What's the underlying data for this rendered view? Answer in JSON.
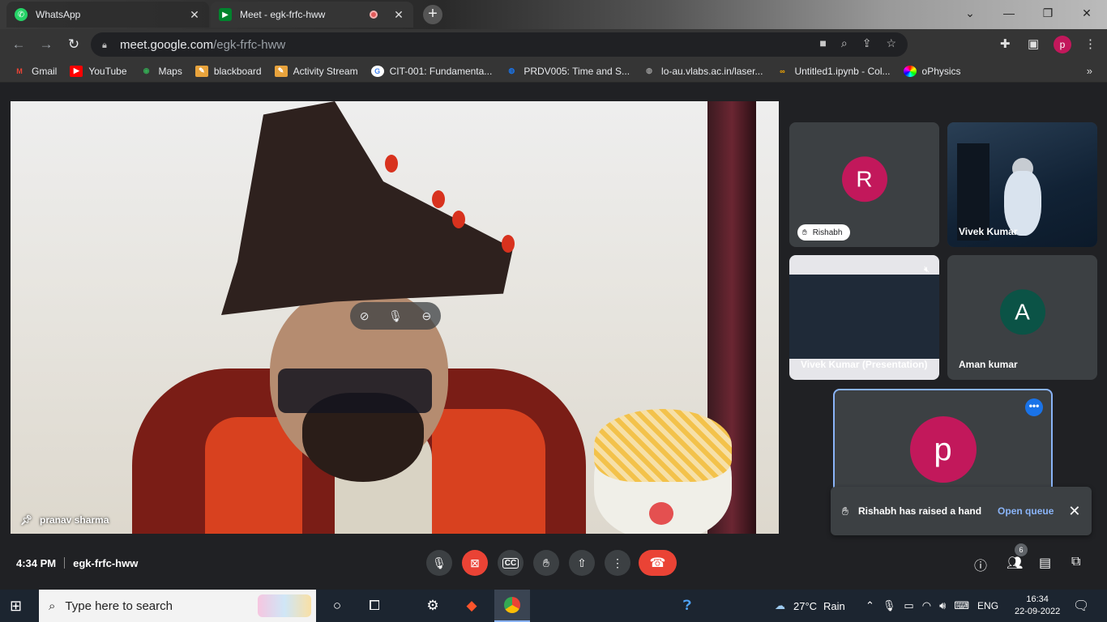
{
  "browser": {
    "tabs": [
      {
        "title": "WhatsApp",
        "icon": "whatsapp-icon",
        "close": "✕"
      },
      {
        "title": "Meet - egk-frfc-hww",
        "icon": "meet-icon",
        "close": "✕"
      }
    ],
    "new_tab": "+",
    "window_controls": {
      "minimize": "—",
      "maximize": "❐",
      "close": "✕",
      "tablist": "⌄"
    },
    "url": {
      "host": "meet.google.com",
      "path": "/egk-frfc-hww"
    },
    "profile_letter": "p",
    "bookmarks": [
      {
        "label": "Gmail",
        "color": "#ea4335",
        "glyph": "M"
      },
      {
        "label": "YouTube",
        "color": "#ff0000",
        "glyph": "▶"
      },
      {
        "label": "Maps",
        "color": "#34a853",
        "glyph": "◉"
      },
      {
        "label": "blackboard",
        "color": "#e8a33c",
        "glyph": "✎"
      },
      {
        "label": "Activity Stream",
        "color": "#e8a33c",
        "glyph": "✎"
      },
      {
        "label": "CIT-001: Fundamenta...",
        "color": "#ffffff",
        "glyph": "G"
      },
      {
        "label": "PRDV005: Time and S...",
        "color": "#1a73e8",
        "glyph": "S"
      },
      {
        "label": "lo-au.vlabs.ac.in/laser...",
        "color": "#777777",
        "glyph": "◍"
      },
      {
        "label": "Untitled1.ipynb - Col...",
        "color": "#f9ab00",
        "glyph": "∞"
      },
      {
        "label": "oPhysics",
        "color": "#9c27b0",
        "glyph": "●"
      }
    ],
    "bookmarks_more": "»"
  },
  "meet": {
    "main_participant": {
      "name": "pranav sharma"
    },
    "tiles": [
      {
        "name": "Rishabh",
        "letter": "R",
        "color": "#c2185b",
        "hand_raised": true
      },
      {
        "name": "Vivek Kumar",
        "video": true
      },
      {
        "name": "Vivek Kumar (Presentation)",
        "presentation": true,
        "muted": true
      },
      {
        "name": "Aman kumar",
        "letter": "A",
        "color": "#0b5346"
      }
    ],
    "self_tile": {
      "letter": "p",
      "color": "#c2185b",
      "more": "•••"
    },
    "toast": {
      "message": "Rishabh has raised a hand",
      "action": "Open queue",
      "close": "✕"
    },
    "time": "4:34 PM",
    "meeting_code": "egk-frfc-hww",
    "participants_count": "6"
  },
  "taskbar": {
    "search_placeholder": "Type here to search",
    "weather": {
      "temp": "27°C",
      "condition": "Rain"
    },
    "language": "ENG",
    "clock": {
      "time": "16:34",
      "date": "22-09-2022"
    }
  }
}
